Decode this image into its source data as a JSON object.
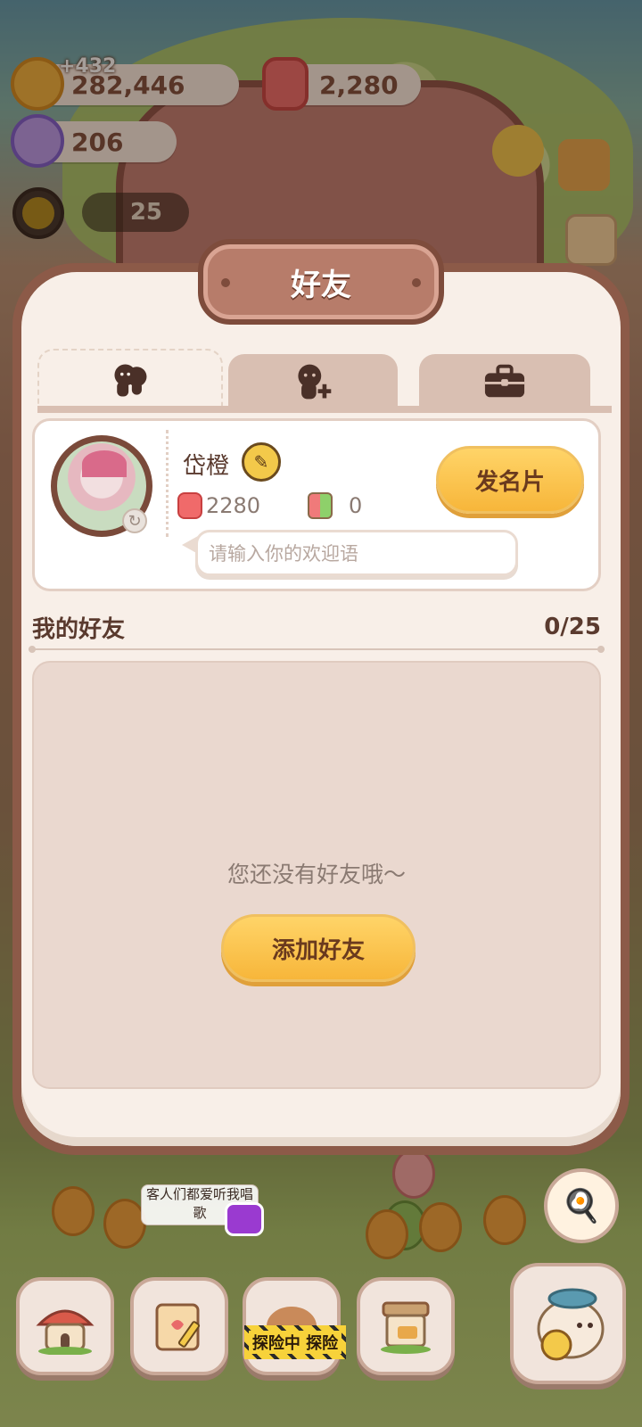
{
  "hud": {
    "coins": "282,446",
    "coin_gain": "+432",
    "candles": "2,280",
    "candies": "206",
    "level": "25"
  },
  "panel": {
    "title": "好友",
    "tabs": [
      {
        "name": "friends-list",
        "icon": "friends-icon",
        "active": true
      },
      {
        "name": "add-friend",
        "icon": "add-friend-icon",
        "active": false
      },
      {
        "name": "bag",
        "icon": "bag-icon",
        "active": false
      }
    ]
  },
  "profile": {
    "name": "岱橙",
    "candles": "2280",
    "gifts": "0",
    "send_card_label": "发名片",
    "greeting_placeholder": "请输入你的欢迎语"
  },
  "friends": {
    "header": "我的好友",
    "count": "0/25",
    "empty_text": "您还没有好友哦～",
    "add_label": "添加好友"
  },
  "bottom": {
    "speech": "客人们都爱听我唱歌",
    "adventure_label": "探险中 探险"
  },
  "colors": {
    "panel_border": "#8c5a48",
    "panel_bg": "#f8efe8",
    "button_yellow": "#f7b63a",
    "text_brown": "#5a3a2e"
  }
}
